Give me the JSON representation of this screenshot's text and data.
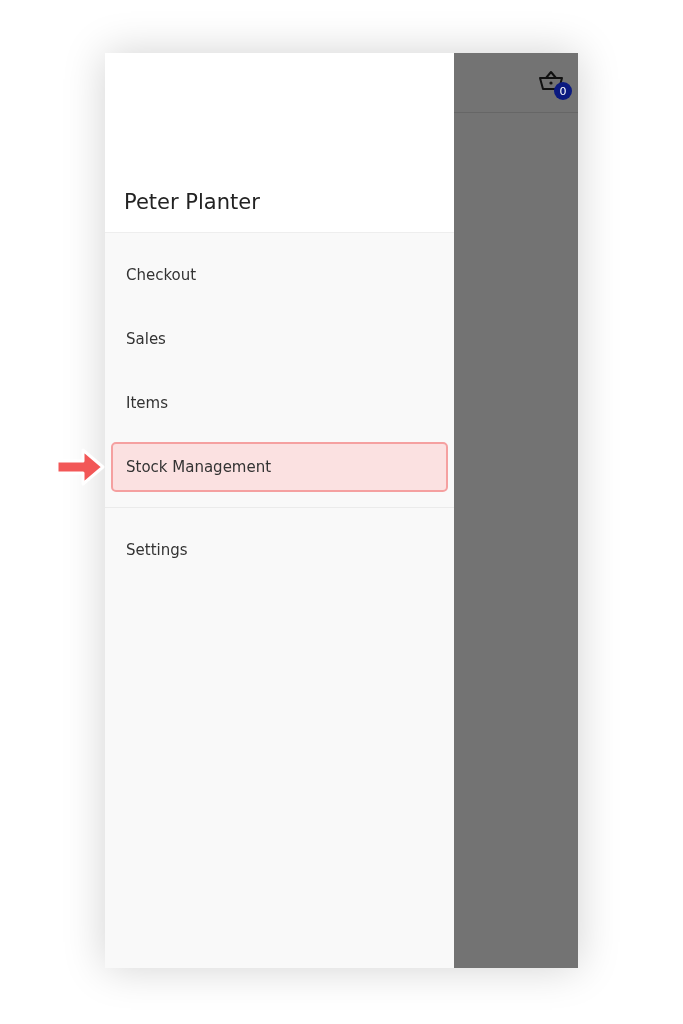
{
  "drawer": {
    "user_name": "Peter Planter",
    "sections": [
      {
        "items": [
          {
            "label": "Checkout",
            "highlighted": false
          },
          {
            "label": "Sales",
            "highlighted": false
          },
          {
            "label": "Items",
            "highlighted": false
          },
          {
            "label": "Stock Management",
            "highlighted": true
          }
        ]
      },
      {
        "items": [
          {
            "label": "Settings",
            "highlighted": false
          }
        ]
      }
    ]
  },
  "app_bar": {
    "cart_count": "0"
  }
}
